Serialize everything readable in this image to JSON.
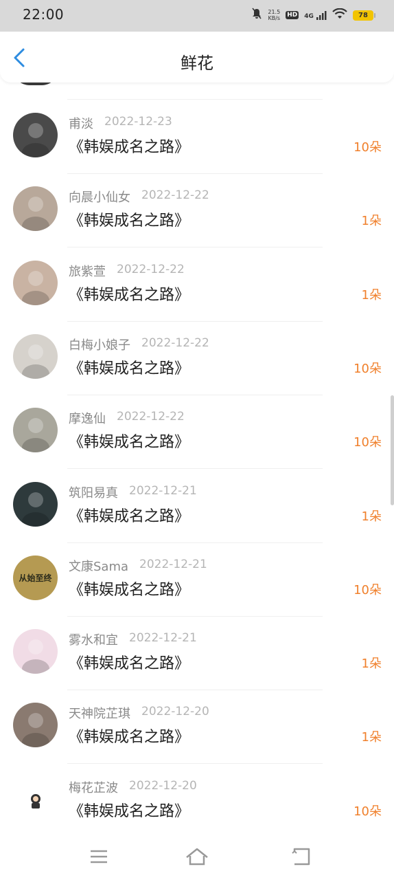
{
  "status_bar": {
    "time": "22:00",
    "speed_value": "21.5",
    "speed_unit": "KB/s",
    "hd_label": "HD",
    "network": "4G",
    "battery": "78"
  },
  "header": {
    "title": "鲜花"
  },
  "rows": [
    {
      "name": "甫淡",
      "date": "2022-12-23",
      "book": "《韩娱成名之路》",
      "count": "10朵",
      "avatar_color": "#4a4a4a",
      "avatar_icon": "car-photo-icon"
    },
    {
      "name": "向晨小仙女",
      "date": "2022-12-22",
      "book": "《韩娱成名之路》",
      "count": "1朵",
      "avatar_color": "#b8a89a",
      "avatar_icon": "birdcage-photo-icon"
    },
    {
      "name": "旅紫萱",
      "date": "2022-12-22",
      "book": "《韩娱成名之路》",
      "count": "1朵",
      "avatar_color": "#c9b3a3",
      "avatar_icon": "girl-with-cat-photo-icon"
    },
    {
      "name": "白梅小娘子",
      "date": "2022-12-22",
      "book": "《韩娱成名之路》",
      "count": "10朵",
      "avatar_color": "#d6d2cc",
      "avatar_icon": "girl-portrait-photo-icon"
    },
    {
      "name": "摩逸仙",
      "date": "2022-12-22",
      "book": "《韩娱成名之路》",
      "count": "10朵",
      "avatar_color": "#a9a79c",
      "avatar_icon": "sketch-portrait-photo-icon"
    },
    {
      "name": "筑阳易真",
      "date": "2022-12-21",
      "book": "《韩娱成名之路》",
      "count": "1朵",
      "avatar_color": "#2e3a3c",
      "avatar_icon": "woman-portrait-photo-icon"
    },
    {
      "name": "文康Sama",
      "date": "2022-12-21",
      "book": "《韩娱成名之路》",
      "count": "10朵",
      "avatar_color": "#b59a52",
      "avatar_icon": "text-badge-icon",
      "avatar_text": "从始至终"
    },
    {
      "name": "雾水和宜",
      "date": "2022-12-21",
      "book": "《韩娱成名之路》",
      "count": "1朵",
      "avatar_color": "#f1dce6",
      "avatar_icon": "anime-fox-mask-icon"
    },
    {
      "name": "天神院芷琪",
      "date": "2022-12-20",
      "book": "《韩娱成名之路》",
      "count": "1朵",
      "avatar_color": "#8a7a70",
      "avatar_icon": "girl-selfie-photo-icon"
    },
    {
      "name": "梅花芷波",
      "date": "2022-12-20",
      "book": "《韩娱成名之路》",
      "count": "10朵",
      "avatar_color": "#ffffff",
      "avatar_icon": "cartoon-character-icon"
    }
  ],
  "accent_color": "#f0802c",
  "back_color": "#2d8ce0"
}
